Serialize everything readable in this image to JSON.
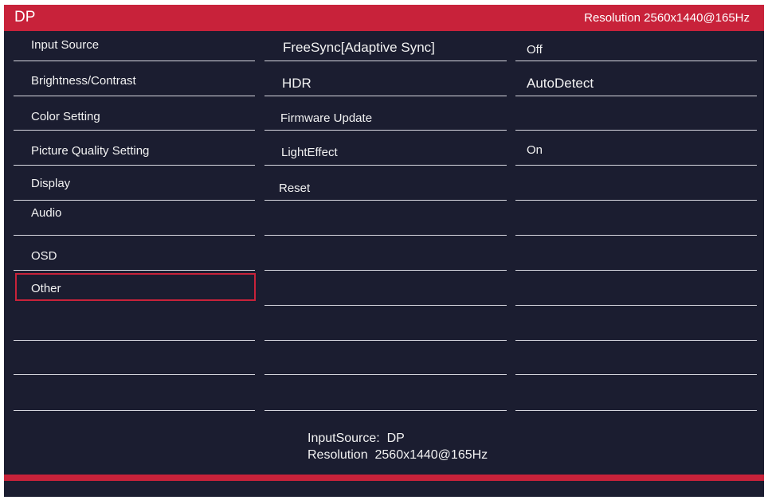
{
  "header": {
    "source": "DP",
    "resolution": "Resolution  2560x1440@165Hz"
  },
  "menu": [
    "Input Source",
    "Brightness/Contrast",
    "Color Setting",
    "Picture Quality Setting",
    "Display",
    "Audio",
    "OSD",
    "Other"
  ],
  "selected_menu": "Other",
  "submenu": [
    "FreeSync[Adaptive Sync]",
    "HDR",
    "Firmware Update",
    "LightEffect",
    "Reset"
  ],
  "values": [
    "Off",
    "AutoDetect",
    "",
    "On",
    ""
  ],
  "info": {
    "input_source": "InputSource:  DP",
    "resolution": "Resolution  2560x1440@165Hz"
  },
  "colors": {
    "accent": "#c8223a",
    "background": "#1b1d30"
  }
}
